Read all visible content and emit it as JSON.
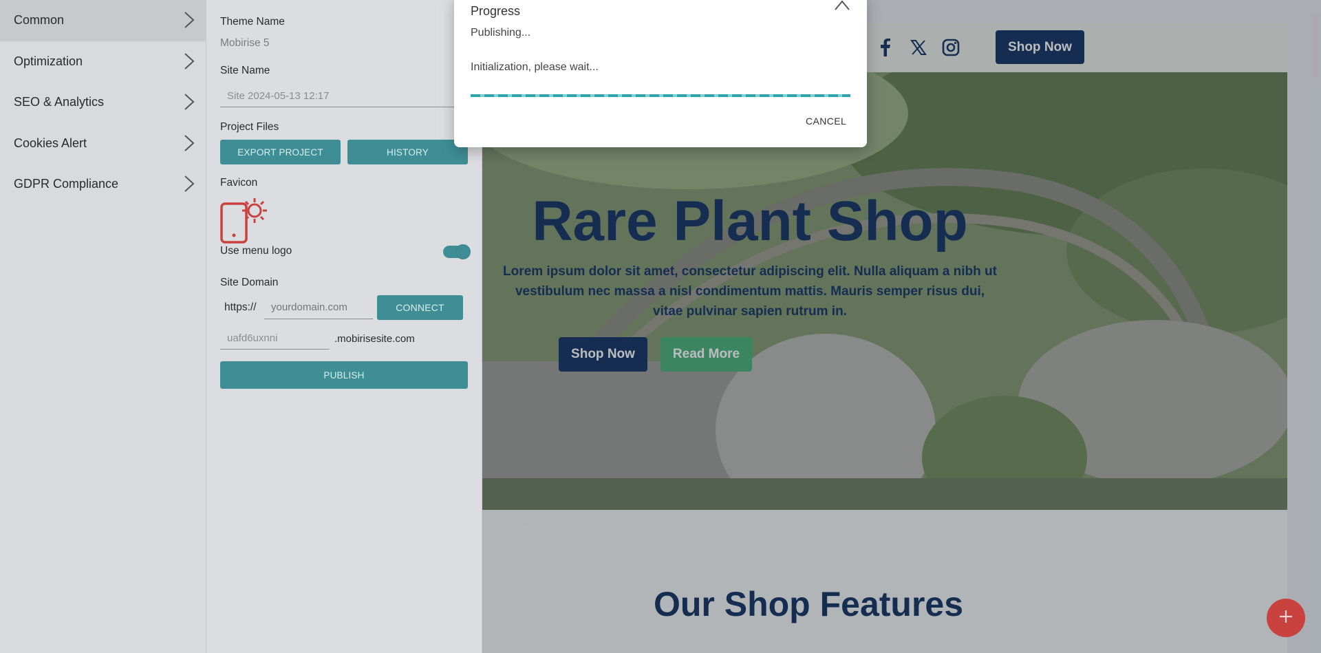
{
  "menu": {
    "items": [
      {
        "label": "Common"
      },
      {
        "label": "Optimization"
      },
      {
        "label": "SEO & Analytics"
      },
      {
        "label": "Cookies Alert"
      },
      {
        "label": "GDPR Compliance"
      }
    ]
  },
  "panel": {
    "theme_name_label": "Theme Name",
    "theme_name_value": "Mobirise 5",
    "site_name_label": "Site Name",
    "site_name_value": "Site 2024-05-13 12:17",
    "project_files_label": "Project Files",
    "export_button": "EXPORT PROJECT",
    "history_button": "HISTORY",
    "favicon_label": "Favicon",
    "menu_logo_label": "Use menu logo",
    "menu_logo_enabled": true,
    "site_domain_label": "Site Domain",
    "protocol": "https://",
    "domain_placeholder": "yourdomain.com",
    "connect_button": "CONNECT",
    "subdomain_value": "uafd6uxnni",
    "subdomain_suffix": ".mobirisesite.com",
    "publish_button": "PUBLISH"
  },
  "modal": {
    "title": "Progress",
    "line1": "Publishing...",
    "line2": "Initialization, please wait...",
    "cancel": "CANCEL",
    "progress_fraction": 1.0
  },
  "site": {
    "nav_shop_button": "Shop Now",
    "hero_title": "Rare Plant Shop",
    "hero_text_1": "Lorem ipsum dolor sit amet, consectetur adipiscing elit. Nulla aliquam a nibh ut",
    "hero_text_2": "vestibulum nec massa a nisl condimentum mattis. Mauris semper risus dui,",
    "hero_text_3": "vitae pulvinar sapien rutrum in.",
    "hero_shop_button": "Shop Now",
    "hero_read_button": "Read More",
    "features_title": "Our Shop Features"
  },
  "colors": {
    "accent": "#3f8e96",
    "brand_navy": "#0c2d5a",
    "read_more_green": "#44b073",
    "fab_red": "#c9423f"
  },
  "icons": [
    "chevron-right-icon",
    "facebook-icon",
    "x-twitter-icon",
    "instagram-icon",
    "phone-favicon-icon",
    "close-icon",
    "plus-icon"
  ]
}
